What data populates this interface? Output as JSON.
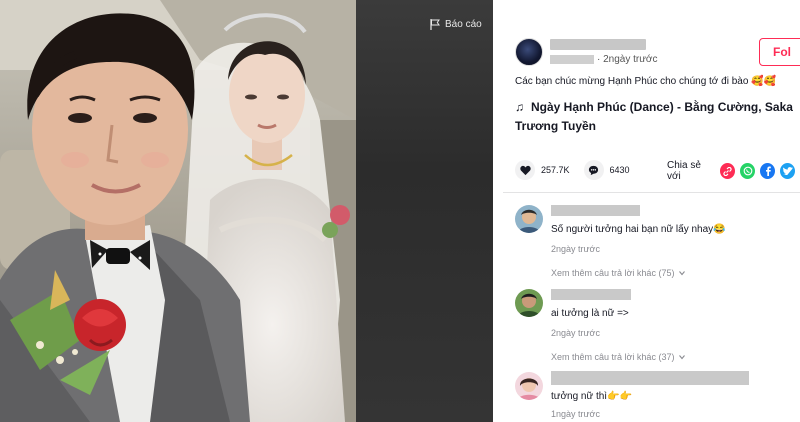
{
  "player": {
    "report_label": "Báo cáo"
  },
  "author": {
    "time_suffix": "· 2ngày trước",
    "follow_label": "Fol"
  },
  "post": {
    "caption": "Các bạn chúc mừng Hạnh Phúc cho chúng tớ đi bào 🥰🥰",
    "music_icon": "♫",
    "music_title": "Ngày Hạnh Phúc (Dance) - Bằng Cường, Saka Trương Tuyền"
  },
  "stats": {
    "likes": "257.7K",
    "comments": "6430",
    "share_label": "Chia sẻ với"
  },
  "comments": [
    {
      "text": "Số người tưởng hai bạn nữ lấy nhay😂",
      "time": "2ngày trước",
      "more": "Xem thêm câu trả lời khác (75)"
    },
    {
      "text": "ai tưởng là nữ =>",
      "time": "2ngày trước",
      "more": "Xem thêm câu trả lời khác (37)"
    },
    {
      "text": "tưởng nữ thì👉👉",
      "time": "1ngày trước"
    }
  ],
  "colors": {
    "accent": "#fe2c55",
    "share_link": "#fe2c55",
    "share_whatsapp": "#25d366",
    "share_facebook": "#1877f2",
    "share_twitter": "#1da1f2"
  }
}
